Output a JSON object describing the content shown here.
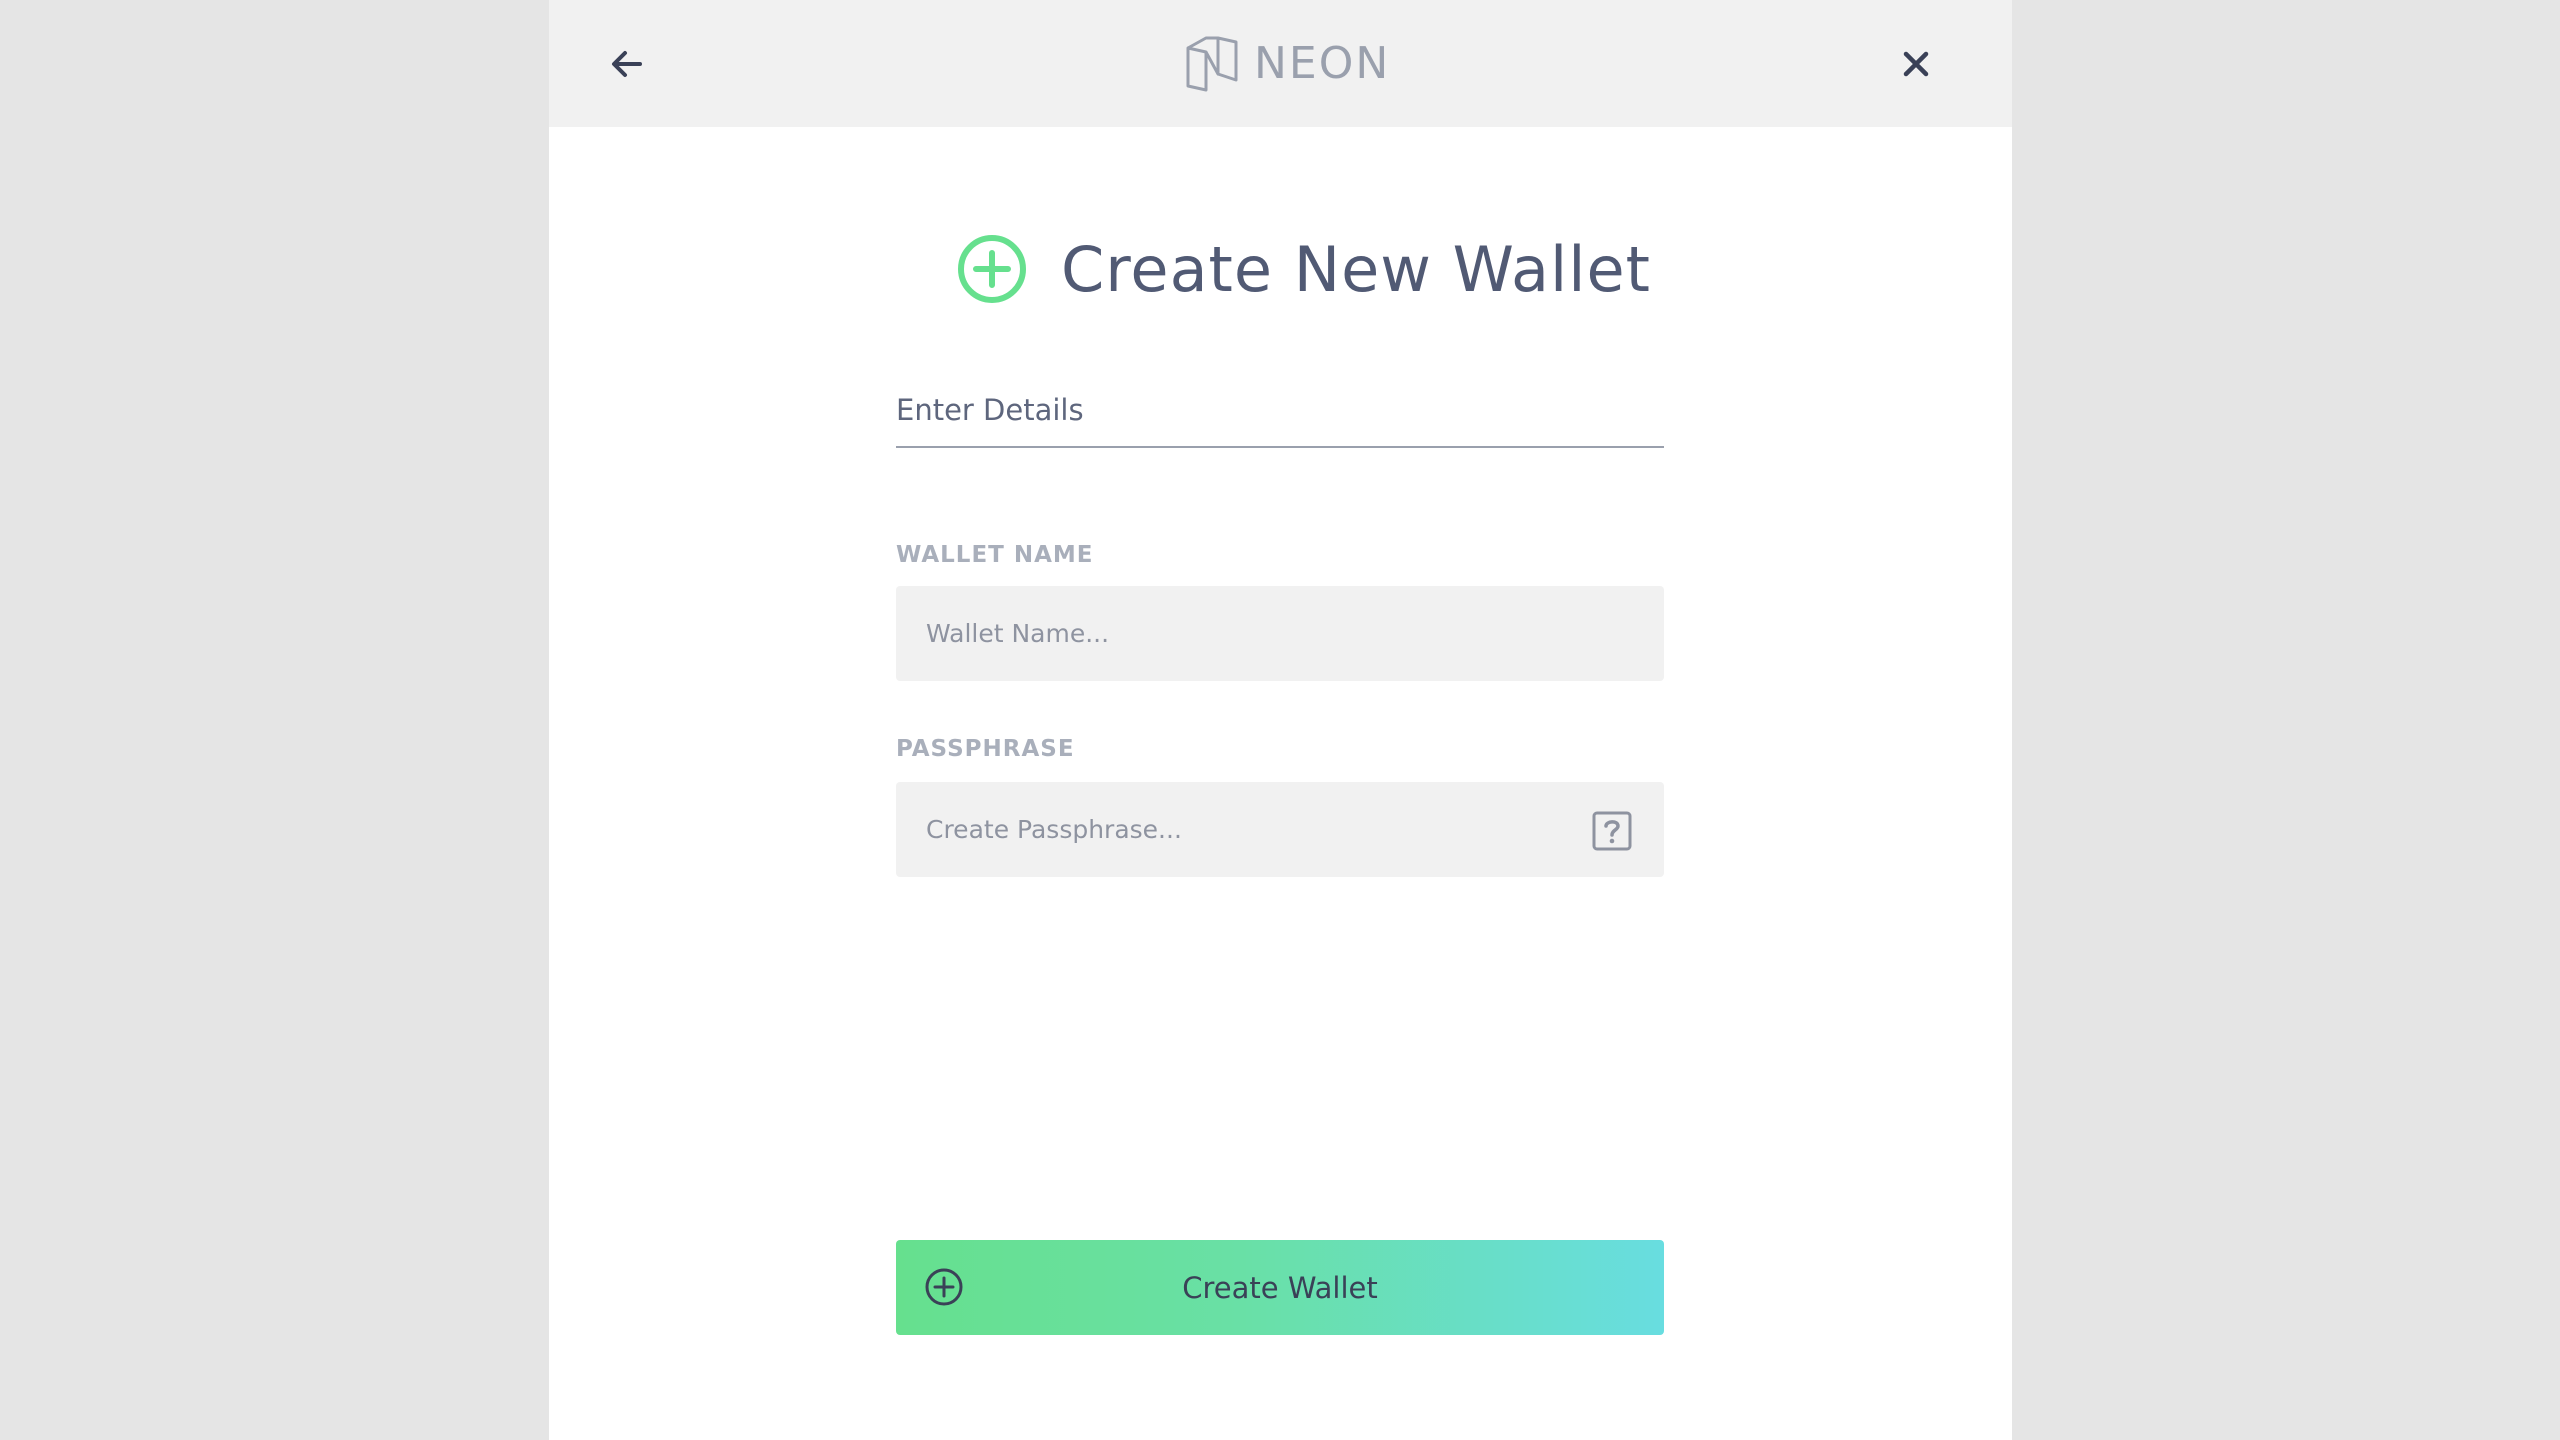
{
  "header": {
    "logo_text": "NEON",
    "back_icon": "arrow-left-icon",
    "close_icon": "close-icon"
  },
  "main": {
    "title": "Create New Wallet",
    "title_icon": "plus-circle-icon",
    "section_label": "Enter Details"
  },
  "form": {
    "wallet_name": {
      "label": "WALLET NAME",
      "placeholder": "Wallet Name...",
      "value": ""
    },
    "passphrase": {
      "label": "PASSPHRASE",
      "placeholder": "Create Passphrase...",
      "value": "",
      "help_icon": "question-mark-icon"
    }
  },
  "actions": {
    "create_label": "Create Wallet",
    "create_icon": "plus-circle-icon"
  },
  "colors": {
    "accent_green": "#66e08e",
    "accent_cyan": "#68dde0",
    "text_dark": "#515a74",
    "label_muted": "#a9afbb",
    "input_bg": "#f1f1f1"
  }
}
